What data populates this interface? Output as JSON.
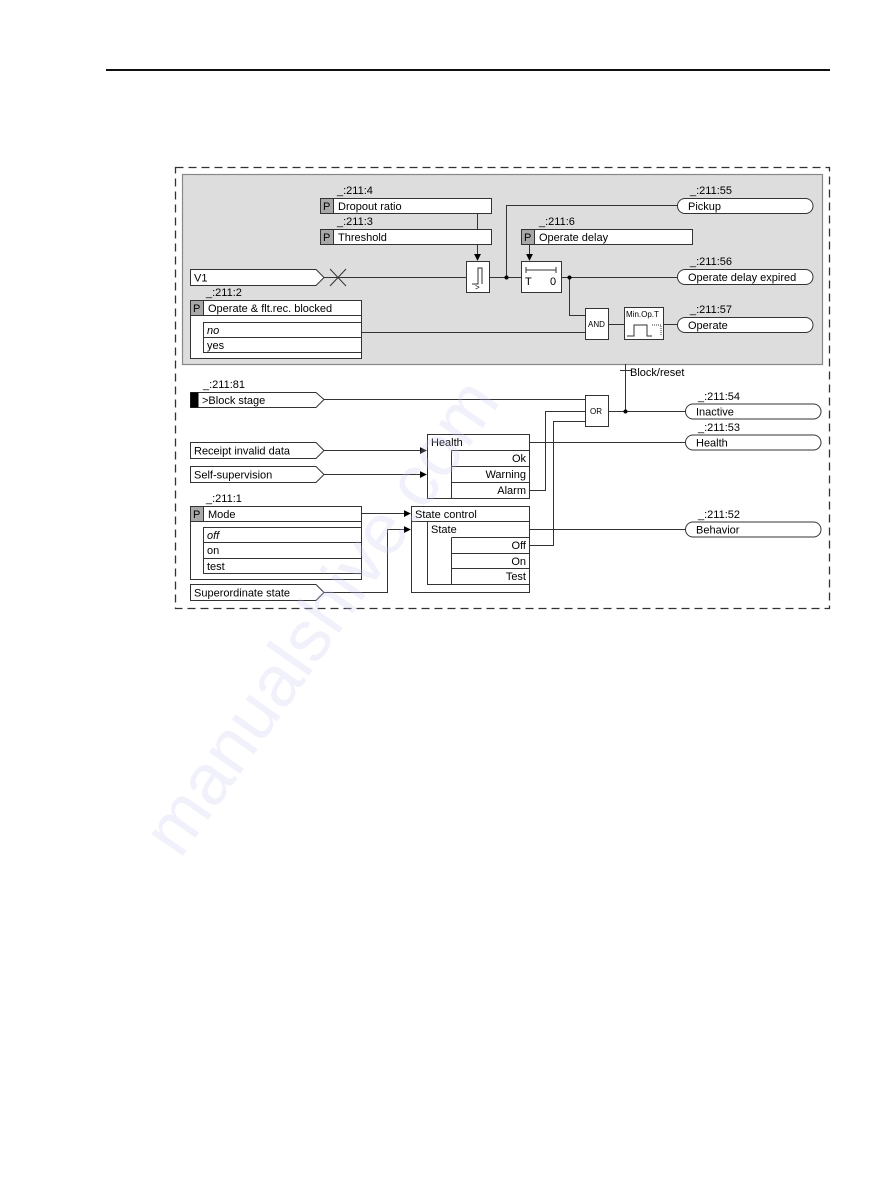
{
  "page": {
    "header_rule": true
  },
  "diagram": {
    "watermark": "manualshive.com",
    "params": {
      "dropout_ratio": {
        "id": "_:211:4",
        "p": "P",
        "label": "Dropout ratio"
      },
      "threshold": {
        "id": "_:211:3",
        "p": "P",
        "label": "Threshold"
      },
      "operate_delay": {
        "id": "_:211:6",
        "p": "P",
        "label": "Operate delay"
      },
      "operate_blocked": {
        "id": "_:211:2",
        "p": "P",
        "label": "Operate & flt.rec. blocked",
        "options": [
          "no",
          "yes"
        ]
      },
      "mode": {
        "id": "_:211:1",
        "p": "P",
        "label": "Mode",
        "options": [
          "off",
          "on",
          "test"
        ]
      }
    },
    "inputs": {
      "v1": {
        "label": "V1"
      },
      "block_stage": {
        "id": "_:211:81",
        "label": ">Block stage"
      },
      "receipt_invalid": {
        "label": "Receipt invalid data"
      },
      "self_supervision": {
        "label": "Self-supervision"
      },
      "superordinate": {
        "label": "Superordinate state"
      }
    },
    "outputs": {
      "pickup": {
        "id": "_:211:55",
        "label": "Pickup"
      },
      "op_delay_expired": {
        "id": "_:211:56",
        "label": "Operate delay expired"
      },
      "operate": {
        "id": "_:211:57",
        "label": "Operate"
      },
      "inactive": {
        "id": "_:211:54",
        "label": "Inactive"
      },
      "health": {
        "id": "_:211:53",
        "label": "Health"
      },
      "behavior": {
        "id": "_:211:52",
        "label": "Behavior"
      }
    },
    "blocks": {
      "threshold_symbol": ">",
      "timer_t": "T",
      "timer_0": "0",
      "and": "AND",
      "min_op": "Min.Op.T",
      "or": "OR",
      "block_reset": "Block/reset",
      "health": {
        "title": "Health",
        "rows": [
          "Ok",
          "Warning",
          "Alarm"
        ]
      },
      "state_control": {
        "title": "State control",
        "sub": "State",
        "rows": [
          "Off",
          "On",
          "Test"
        ]
      }
    }
  }
}
